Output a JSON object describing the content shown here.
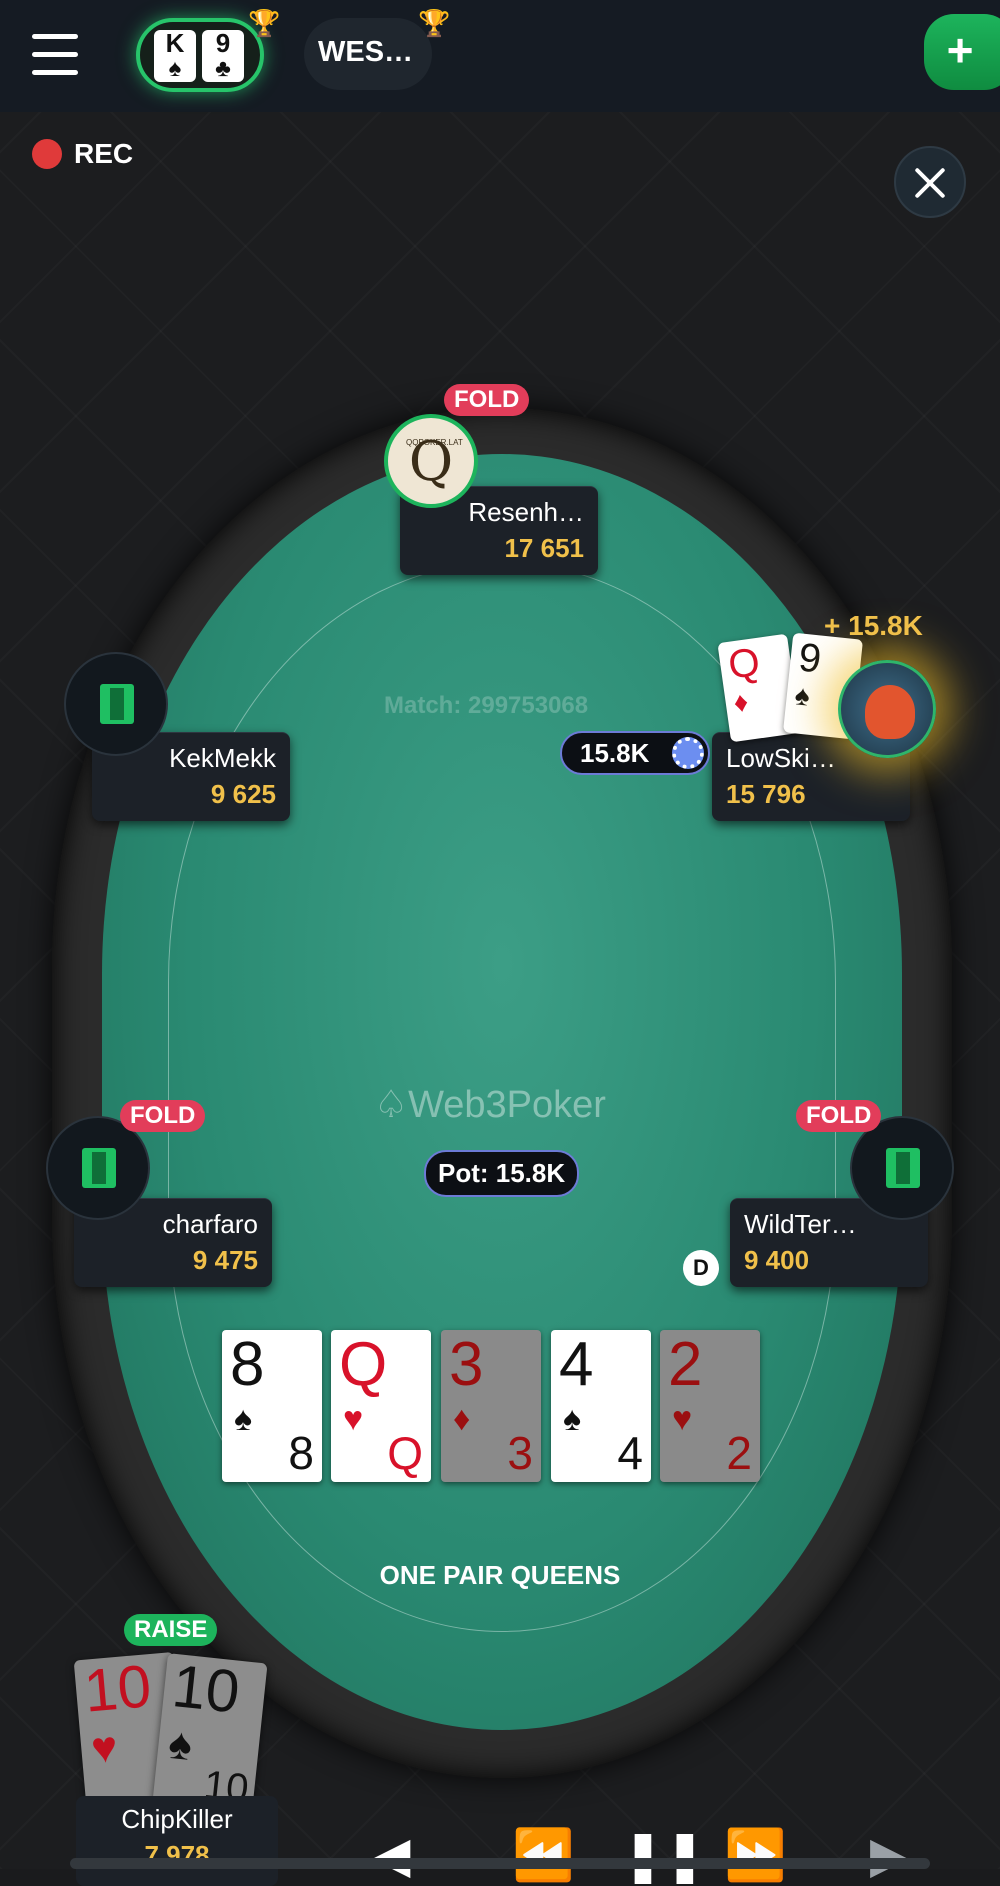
{
  "header": {
    "tab1": {
      "cards": [
        {
          "rank": "K",
          "suit": "♠"
        },
        {
          "rank": "9",
          "suit": "♣"
        }
      ]
    },
    "tab2": {
      "label": "WES…"
    },
    "add_label": "+"
  },
  "rec_label": "REC",
  "table": {
    "match": "Match: 299753068",
    "logo": "Web3Poker",
    "pot": "Pot: 15.8K",
    "hand_result": "ONE PAIR QUEENS",
    "dealer": "D",
    "board": [
      {
        "rank": "8",
        "suit": "♠",
        "color": "#111111",
        "dim": false
      },
      {
        "rank": "Q",
        "suit": "♥",
        "color": "#d8122a",
        "dim": false
      },
      {
        "rank": "3",
        "suit": "♦",
        "color": "#9b0f10",
        "dim": true
      },
      {
        "rank": "4",
        "suit": "♠",
        "color": "#111111",
        "dim": false
      },
      {
        "rank": "2",
        "suit": "♥",
        "color": "#9b0f10",
        "dim": true
      }
    ]
  },
  "players": {
    "top": {
      "name": "Resenh…",
      "stack": "17 651",
      "action": "FOLD",
      "avatar_text": "QQPOKER.LAT",
      "avatar_letter": "Q"
    },
    "left": {
      "name": "KekMekk",
      "stack": "9 625"
    },
    "right": {
      "name": "LowSki…",
      "stack": "15 796",
      "bet": "15.8K",
      "win": "+ 15.8K",
      "cards": [
        {
          "rank": "Q",
          "suit": "♦",
          "color": "#d8122a"
        },
        {
          "rank": "9",
          "suit": "♠",
          "color": "#111111"
        }
      ]
    },
    "lower_left": {
      "name": "charfaro",
      "stack": "9 475",
      "action": "FOLD"
    },
    "lower_right": {
      "name": "WildTer…",
      "stack": "9 400",
      "action": "FOLD"
    },
    "hero": {
      "name": "ChipKiller",
      "stack": "7 978",
      "action": "RAISE",
      "cards": [
        {
          "rank": "10",
          "suit": "♥",
          "color": "#c21020"
        },
        {
          "rank": "10",
          "suit": "♠",
          "color": "#111111"
        }
      ]
    }
  },
  "colors": {
    "felt": "#2a8a72",
    "fold": "#e23d5a",
    "raise": "#1db45c",
    "stack": "#f0c04a"
  }
}
